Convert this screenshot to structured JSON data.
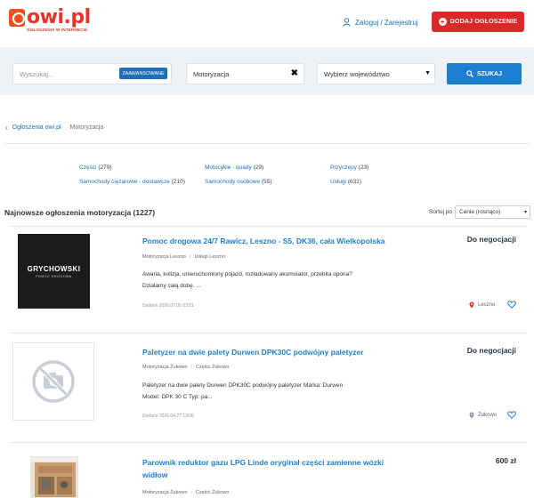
{
  "header": {
    "logo_name": "owi.pl",
    "logo_tagline": "OGŁOSZENIA W INTERNECIE",
    "login_label": "Zaloguj / Zarejestruj",
    "add_button_label": "DODAJ OGŁOSZENIE"
  },
  "search": {
    "placeholder": "Wyszukaj...",
    "advanced_label": "ZAAWANSOWANE",
    "category_value": "Motoryzacja",
    "region_value": "Wybierz województwo",
    "submit_label": "SZUKAJ"
  },
  "breadcrumb": {
    "home": "Ogłoszenia owi.pl",
    "current": "Motoryzacja"
  },
  "subcategories": [
    {
      "label": "Części",
      "count": "(279)"
    },
    {
      "label": "Samochody ciężarowe - dostawcze",
      "count": "(210)"
    },
    {
      "label": "Motocykle - quady",
      "count": "(29)"
    },
    {
      "label": "Samochody osobowe",
      "count": "(55)"
    },
    {
      "label": "Przyczepy",
      "count": "(23)"
    },
    {
      "label": "Usługi",
      "count": "(631)"
    }
  ],
  "listing": {
    "title": "Najnowsze ogłoszenia motoryzacja (1227)",
    "sort_label": "Sortuj po",
    "sort_value": "Cenie (rosnąco)"
  },
  "ads": [
    {
      "title": "Pomoc drogowa 24/7 Rawicz, Leszno - S5, DK36, cała Wielkopolska",
      "price": "Do negocjacji",
      "cat1": "Motoryzacja Leszno",
      "cat2": "Usługi Leszno",
      "desc": "Awaria, kolizja, unieruchomiony pojazd, rozładowany akumulator, przebita opona? Działamy całą dobę. ...",
      "added": "Dodano 2026.07.05 03:01",
      "location": "Leszno",
      "thumb_brand": "GRYCHOWSKI",
      "thumb_sub": "POMOC DROGOWA"
    },
    {
      "title": "Paletyzer na dwie palety Durwen DPK30C podwójny paletyzer",
      "price": "Do negocjacji",
      "cat1": "Motoryzacja Żukowo",
      "cat2": "Części Żukowo",
      "desc": "Paletyzer na dwie palety Durwen DPK30C podwójny paletyzer Marka: Durwen Model: DPK 30 C Typ: pa...",
      "added": "Dodano 2026.04.27 13:06",
      "location": "Żukowo"
    },
    {
      "title": "Parownik reduktor gazu LPG Linde oryginał części zamienne wózki widłow",
      "price": "600 zł",
      "cat1": "Motoryzacja Żukowo",
      "cat2": "Części Żukowo"
    }
  ],
  "colors": {
    "brand_red": "#d92a27",
    "link_blue": "#1d7fd1",
    "band_bg": "#eef1f6"
  }
}
